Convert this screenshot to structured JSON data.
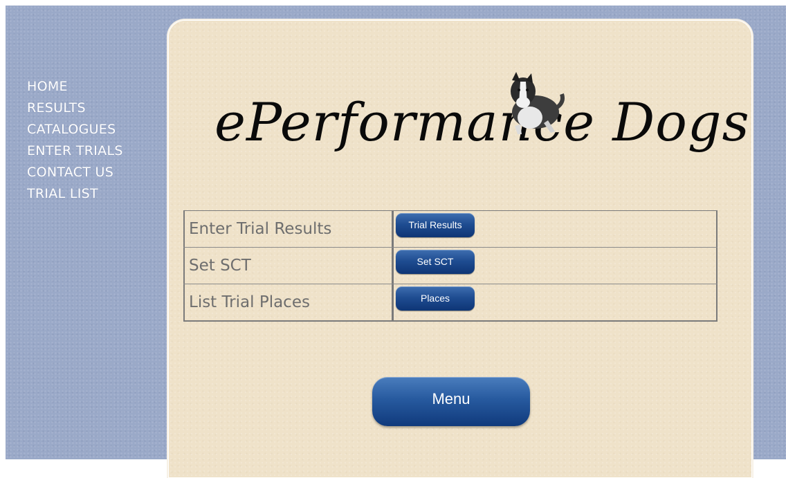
{
  "sidebar": {
    "items": [
      {
        "label": "HOME"
      },
      {
        "label": "RESULTS"
      },
      {
        "label": "CATALOGUES"
      },
      {
        "label": "ENTER TRIALS"
      },
      {
        "label": "CONTACT US"
      },
      {
        "label": "TRIAL LIST"
      }
    ]
  },
  "logo": {
    "text": "ePerformance Dogs",
    "icon": "border-collie-dog"
  },
  "actions": [
    {
      "label": "Enter Trial Results",
      "button": "Trial Results"
    },
    {
      "label": "Set SCT",
      "button": "Set SCT"
    },
    {
      "label": "List Trial Places",
      "button": "Places"
    }
  ],
  "menu_button": "Menu",
  "colors": {
    "background": "#9aa9c8",
    "panel": "#efe2c9",
    "button": "#1f4d92",
    "nav_text": "#ffffff",
    "label_text": "#6e6e6e"
  }
}
